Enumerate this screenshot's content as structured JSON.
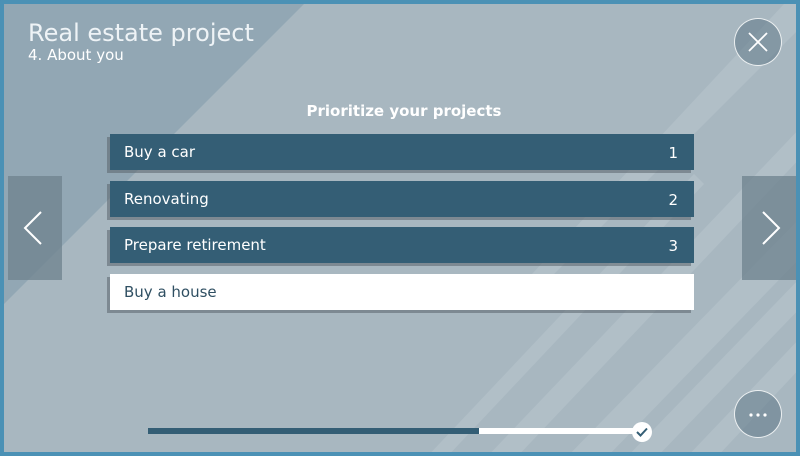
{
  "header": {
    "title": "Real estate project",
    "subtitle": "4. About you"
  },
  "section_title": "Prioritize your projects",
  "projects": [
    {
      "label": "Buy a car",
      "rank": "1",
      "state": "ranked"
    },
    {
      "label": "Renovating",
      "rank": "2",
      "state": "ranked"
    },
    {
      "label": "Prepare retirement",
      "rank": "3",
      "state": "ranked"
    },
    {
      "label": "Buy a house",
      "rank": "",
      "state": "unranked"
    }
  ],
  "progress": {
    "fraction": 0.66,
    "complete_icon": "check-icon"
  },
  "icons": {
    "close": "close-icon",
    "more": "more-icon",
    "prev": "chevron-left-icon",
    "next": "chevron-right-icon"
  },
  "colors": {
    "accent": "#345e75",
    "background": "#a8b7c0",
    "border": "#4b91b5"
  }
}
